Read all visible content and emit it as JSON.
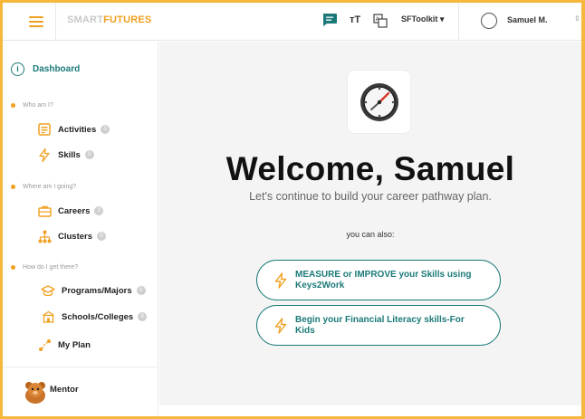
{
  "topbar": {
    "logo_part1": "SMART",
    "logo_part2": "FUTURES",
    "toolkit_label": "SFToolkit",
    "toolkit_caret": "▾",
    "user_name": "Samuel M.",
    "user_caret": "⌃⌄"
  },
  "sidebar": {
    "dashboard_label": "Dashboard",
    "sections": [
      {
        "label": "Who am I?"
      },
      {
        "label": "Where am I going?"
      },
      {
        "label": "How do I get there?"
      }
    ],
    "items": [
      {
        "label": "Activities",
        "icon": "activities-icon"
      },
      {
        "label": "Skills",
        "icon": "bolt-icon"
      },
      {
        "label": "Careers",
        "icon": "briefcase-icon"
      },
      {
        "label": "Clusters",
        "icon": "cluster-icon"
      },
      {
        "label": "Programs/Majors",
        "icon": "graduation-cap-icon"
      },
      {
        "label": "Schools/Colleges",
        "icon": "school-icon"
      },
      {
        "label": "My Plan",
        "icon": "plan-icon"
      }
    ],
    "mentor_label": "Mentor"
  },
  "main": {
    "welcome": "Welcome, Samuel",
    "subtitle": "Let's continue to build your career pathway plan.",
    "also_label": "you can also:",
    "actions": [
      {
        "label": "MEASURE or IMPROVE your Skills using Keys2Work"
      },
      {
        "label": "Begin your Financial Literacy skills-For Kids"
      }
    ]
  },
  "colors": {
    "accent": "#f0a020",
    "teal": "#1b7a78"
  }
}
